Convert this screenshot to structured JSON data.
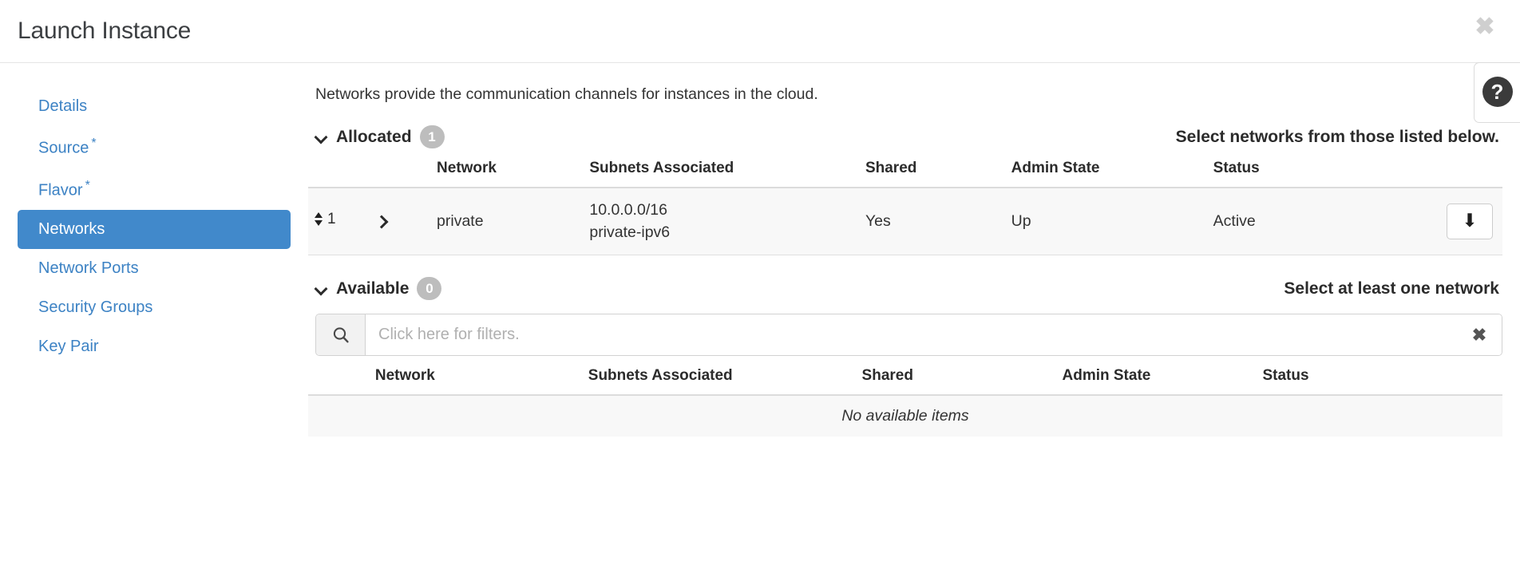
{
  "header": {
    "title": "Launch Instance",
    "close_label": "✖"
  },
  "sidebar": {
    "items": [
      {
        "label": "Details",
        "required": false,
        "active": false
      },
      {
        "label": "Source",
        "required": true,
        "active": false
      },
      {
        "label": "Flavor",
        "required": true,
        "active": false
      },
      {
        "label": "Networks",
        "required": false,
        "active": true
      },
      {
        "label": "Network Ports",
        "required": false,
        "active": false
      },
      {
        "label": "Security Groups",
        "required": false,
        "active": false
      },
      {
        "label": "Key Pair",
        "required": false,
        "active": false
      }
    ],
    "required_marker": "*"
  },
  "main": {
    "description": "Networks provide the communication channels for instances in the cloud.",
    "help_label": "?",
    "allocated": {
      "title": "Allocated",
      "count": "1",
      "hint": "Select networks from those listed below.",
      "columns": [
        "",
        "",
        "Network",
        "Subnets Associated",
        "Shared",
        "Admin State",
        "Status",
        ""
      ],
      "rows": [
        {
          "order": "1",
          "network": "private",
          "subnets": [
            "10.0.0.0/16",
            "private-ipv6"
          ],
          "shared": "Yes",
          "admin_state": "Up",
          "status": "Active",
          "action_label": "↓"
        }
      ]
    },
    "available": {
      "title": "Available",
      "count": "0",
      "hint": "Select at least one network",
      "filter_placeholder": "Click here for filters.",
      "filter_value": "",
      "clear_label": "✖",
      "columns": [
        "",
        "Network",
        "Subnets Associated",
        "Shared",
        "Admin State",
        "Status",
        ""
      ],
      "empty_message": "No available items"
    }
  },
  "colors": {
    "accent": "#4189cb",
    "link": "#3c82c4",
    "badge": "#bdbdbd",
    "row_bg": "#f8f8f8"
  }
}
